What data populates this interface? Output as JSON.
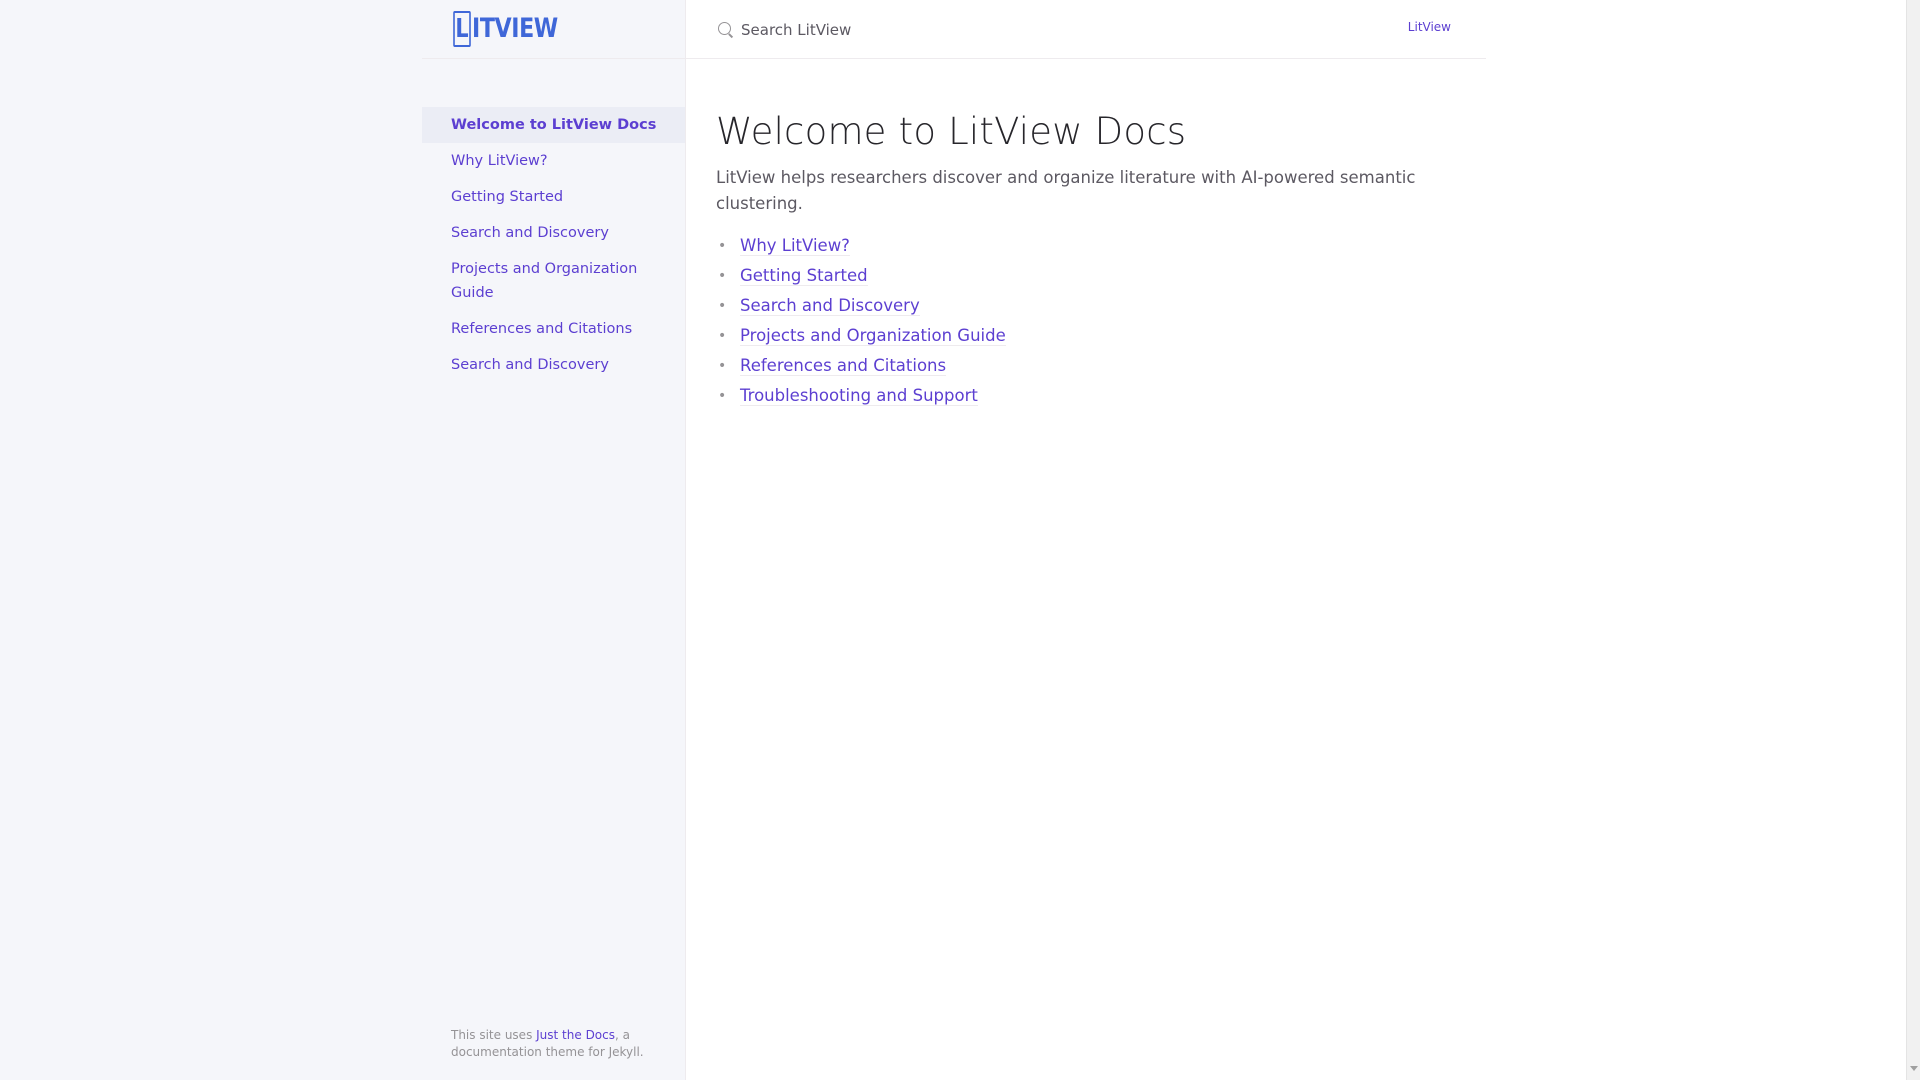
{
  "site": {
    "logo_letter": "L",
    "logo_rest": "ITVIEW"
  },
  "search": {
    "placeholder": "Search LitView"
  },
  "header": {
    "aux_link": "LitView"
  },
  "sidebar": {
    "items": [
      {
        "label": "Welcome to LitView Docs",
        "active": true
      },
      {
        "label": "Why LitView?"
      },
      {
        "label": "Getting Started"
      },
      {
        "label": "Search and Discovery"
      },
      {
        "label": "Projects and Organization Guide"
      },
      {
        "label": "References and Citations"
      },
      {
        "label": "Search and Discovery"
      }
    ],
    "footer": {
      "prefix": "This site uses ",
      "link": "Just the Docs",
      "suffix": ", a documentation theme for Jekyll."
    }
  },
  "main": {
    "title": "Welcome to LitView Docs",
    "intro": "LitView helps researchers discover and organize literature with AI-powered semantic clustering.",
    "bullet_char": "•",
    "toc": [
      "Why LitView?",
      "Getting Started",
      "Search and Discovery",
      "Projects and Organization Guide",
      "References and Citations",
      "Troubleshooting and Support"
    ]
  },
  "colors": {
    "link": "#5c3fd1",
    "logo": "#3f67d8",
    "sidebar_bg": "#f5f6fa"
  }
}
